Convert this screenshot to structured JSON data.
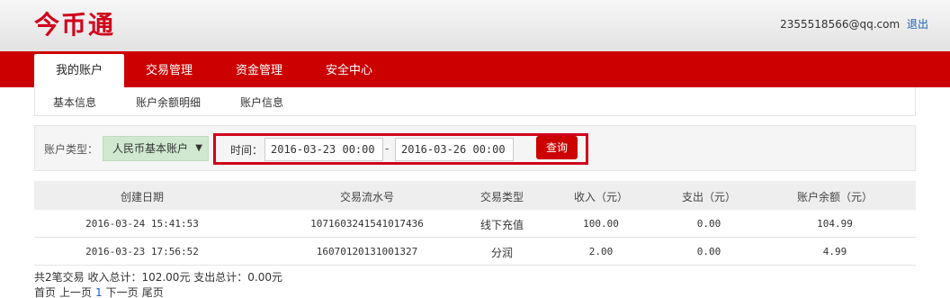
{
  "brand": {
    "logo_text": "今币通",
    "color": "#d0021b"
  },
  "user": {
    "email": "2355518566@qq.com",
    "logout_label": "退出"
  },
  "nav": {
    "tabs": [
      "我的账户",
      "交易管理",
      "资金管理",
      "安全中心"
    ],
    "active": "我的账户"
  },
  "subnav": {
    "items": [
      "基本信息",
      "账户余额明细",
      "账户信息"
    ]
  },
  "filter": {
    "account_type_label": "账户类型：",
    "account_type_value": "人民币基本账户",
    "time_label": "时间：",
    "start": "2016-03-23 00:00",
    "separator": "-",
    "end": "2016-03-26 00:00",
    "query_label": "查询"
  },
  "table": {
    "headers": [
      "创建日期",
      "交易流水号",
      "交易类型",
      "收入（元）",
      "支出（元）",
      "账户余额（元）"
    ],
    "rows": [
      [
        "2016-03-24 15:41:53",
        "1071603241541017436",
        "线下充值",
        "100.00",
        "0.00",
        "104.99"
      ],
      [
        "2016-03-23 17:56:52",
        "16070120131001327",
        "分润",
        "2.00",
        "0.00",
        "4.99"
      ]
    ]
  },
  "summary": "共2笔交易 收入总计：102.00元 支出总计：0.00元",
  "pager": {
    "first": "首页",
    "prev": "上一页",
    "current": "1",
    "next": "下一页",
    "last": "尾页"
  },
  "colors": {
    "accent": "#cc0000",
    "select_bg": "#cfe8cf",
    "link": "#1a5fb4"
  }
}
